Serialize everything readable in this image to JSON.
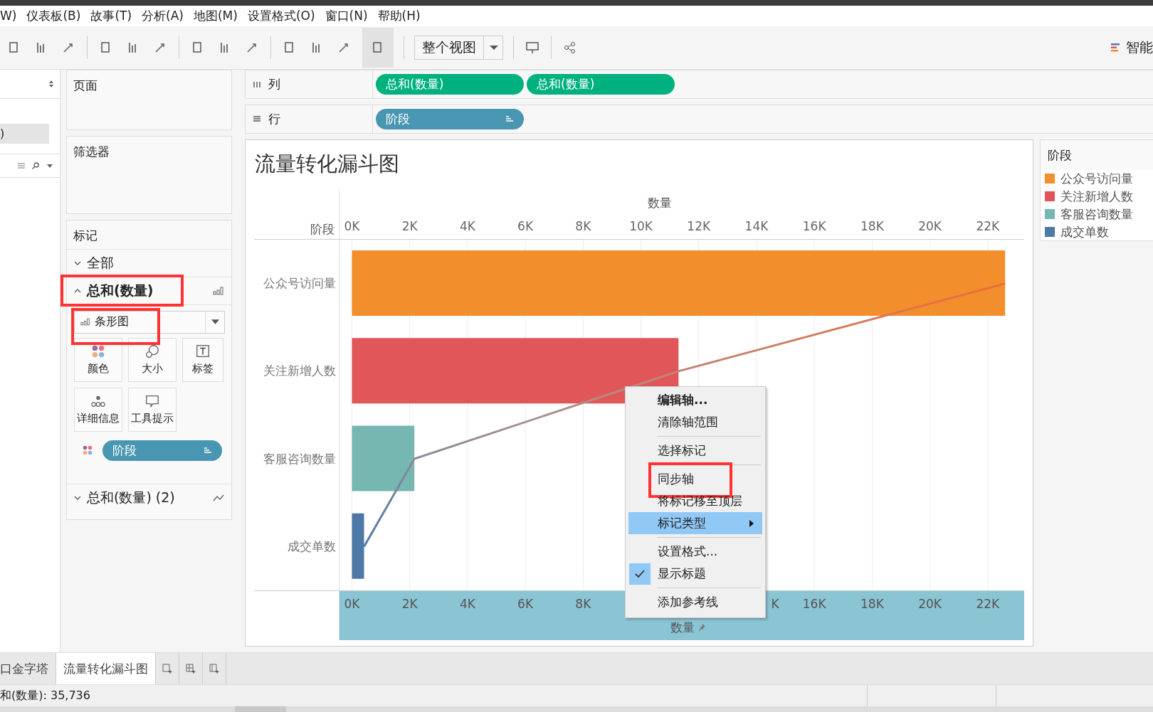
{
  "menu_bar": [
    "W)",
    "仪表板(B)",
    "故事(T)",
    "分析(A)",
    "地图(M)",
    "设置格式(O)",
    "窗口(N)",
    "帮助(H)"
  ],
  "toolbar": {
    "view_mode": "整个视图",
    "show_me": "智能"
  },
  "data_pane": {
    "selected_item": ")"
  },
  "pages_card": {
    "title": "页面"
  },
  "filters_card": {
    "title": "筛选器"
  },
  "marks_card": {
    "title": "标记",
    "sections": [
      {
        "label": "全部",
        "kind": "all",
        "expanded": false,
        "annotated": false
      },
      {
        "label": "总和(数量)",
        "kind": "bar",
        "expanded": true,
        "annotated": true
      },
      {
        "label": "总和(数量) (2)",
        "kind": "line",
        "expanded": false,
        "annotated": false
      }
    ],
    "mark_type": {
      "label": "条形图",
      "annotated": true
    },
    "buttons": [
      {
        "label": "颜色",
        "kind": "color"
      },
      {
        "label": "大小",
        "kind": "size"
      },
      {
        "label": "标签",
        "kind": "label"
      },
      {
        "label": "详细信息",
        "kind": "detail"
      },
      {
        "label": "工具提示",
        "kind": "tooltip"
      }
    ],
    "fields": [
      {
        "label": "阶段"
      }
    ]
  },
  "columns_shelf": {
    "label": "列",
    "pills": [
      {
        "label": "总和(数量)",
        "kind": "measure"
      },
      {
        "label": "总和(数量)",
        "kind": "measure"
      }
    ]
  },
  "rows_shelf": {
    "label": "行",
    "pills": [
      {
        "label": "阶段",
        "kind": "dimension"
      }
    ]
  },
  "sheet": {
    "title": "流量转化漏斗图",
    "bottom_axis": {
      "title": "数量",
      "ticks": [
        "0K",
        "2K",
        "4K",
        "6K",
        "8K",
        "K",
        "16K",
        "18K",
        "20K",
        "22K"
      ]
    },
    "chart_data": {
      "type": "bar",
      "orientation": "horizontal",
      "xlabel": "数量",
      "ylabel": "阶段",
      "categories": [
        "公众号访问量",
        "关注新增人数",
        "客服咨询数量",
        "成交单数"
      ],
      "values": [
        22600,
        11300,
        2160,
        420
      ],
      "grid": true,
      "xlim": [
        -430,
        23260
      ],
      "xticks": [
        {
          "value": 0,
          "label": "0K"
        },
        {
          "value": 2000,
          "label": "2K"
        },
        {
          "value": 4000,
          "label": "4K"
        },
        {
          "value": 6000,
          "label": "6K"
        },
        {
          "value": 8000,
          "label": "8K"
        },
        {
          "value": 10000,
          "label": "10K"
        },
        {
          "value": 12000,
          "label": "12K"
        },
        {
          "value": 14000,
          "label": "14K"
        },
        {
          "value": 16000,
          "label": "16K"
        },
        {
          "value": 18000,
          "label": "18K"
        },
        {
          "value": 20000,
          "label": "20K"
        },
        {
          "value": 22000,
          "label": "22K"
        }
      ]
    }
  },
  "legend": {
    "title": "阶段",
    "items": [
      {
        "label": "公众号访问量",
        "color": "#f28e2b"
      },
      {
        "label": "关注新增人数",
        "color": "#e15759"
      },
      {
        "label": "客服咨询数量",
        "color": "#76b7b2"
      },
      {
        "label": "成交单数",
        "color": "#4e79a7"
      }
    ]
  },
  "context_menu": {
    "items": [
      {
        "kind": "item",
        "label": "编辑轴...",
        "bold": true,
        "selected": false
      },
      {
        "kind": "item",
        "label": "清除轴范围",
        "selected": false
      },
      {
        "kind": "separator"
      },
      {
        "kind": "item",
        "label": "选择标记",
        "selected": false
      },
      {
        "kind": "separator"
      },
      {
        "kind": "item",
        "label": "同步轴",
        "selected": false,
        "annotated": true
      },
      {
        "kind": "item",
        "label": "将标记移至顶层",
        "selected": false
      },
      {
        "kind": "item",
        "label": "标记类型",
        "selected": true,
        "submenu": true
      },
      {
        "kind": "separator"
      },
      {
        "kind": "item",
        "label": "设置格式...",
        "selected": false
      },
      {
        "kind": "item",
        "label": "显示标题",
        "selected": false,
        "checked": true
      },
      {
        "kind": "separator"
      },
      {
        "kind": "item",
        "label": "添加参考线",
        "selected": false
      }
    ]
  },
  "sheet_tabs": [
    {
      "label": "口金字塔",
      "selected": false
    },
    {
      "label": "流量转化漏斗图",
      "selected": true
    }
  ],
  "status_bar": {
    "text": "和(数量): 35,736"
  }
}
